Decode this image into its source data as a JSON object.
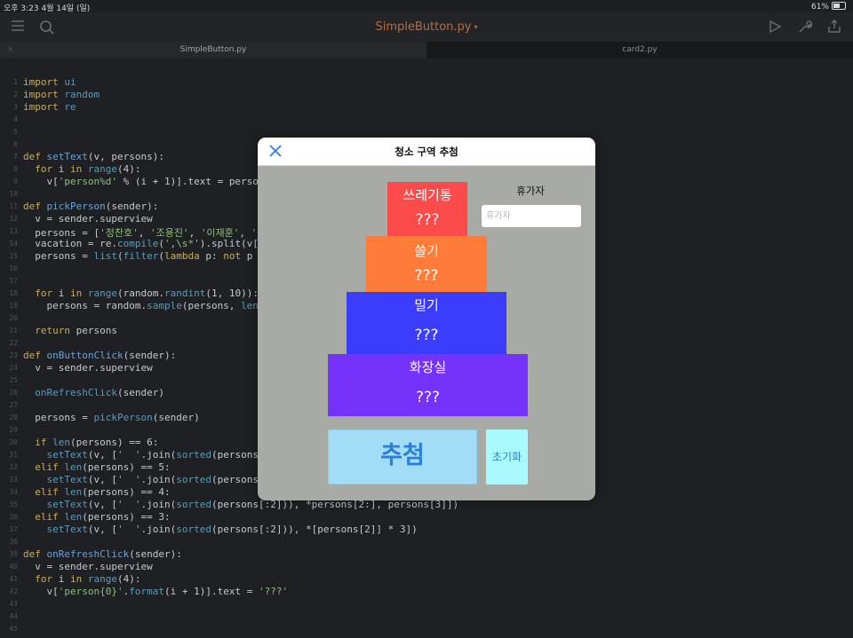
{
  "status_bar": {
    "time_date": "오후 3:23   4월 14일 (일)",
    "battery": "61%"
  },
  "toolbar": {
    "title": "SimpleButton.py",
    "title_caret": "▾"
  },
  "tabs": [
    {
      "label": "SimpleButton.py",
      "close": "×"
    },
    {
      "label": "card2.py"
    }
  ],
  "code_lines": [
    {
      "n": "1",
      "html": "<span class=\"kw\">import</span> <span class=\"bi\">ui</span>"
    },
    {
      "n": "2",
      "html": "<span class=\"kw\">import</span> <span class=\"bi\">random</span>"
    },
    {
      "n": "3",
      "html": "<span class=\"kw\">import</span> <span class=\"bi\">re</span>"
    },
    {
      "n": "4",
      "html": ""
    },
    {
      "n": "5",
      "html": ""
    },
    {
      "n": "6",
      "html": ""
    },
    {
      "n": "7",
      "html": "<span class=\"kw\">def</span> <span class=\"fn\">setText</span>(v, persons):"
    },
    {
      "n": "8",
      "html": "  <span class=\"kw\">for</span> i <span class=\"kw\">in</span> <span class=\"bi\">range</span>(4):"
    },
    {
      "n": "9",
      "html": "    v[<span class=\"st\">'person%d'</span> % (i + 1)].text = persons"
    },
    {
      "n": "10",
      "html": ""
    },
    {
      "n": "11",
      "html": "<span class=\"kw\">def</span> <span class=\"fn\">pickPerson</span>(sender):"
    },
    {
      "n": "12",
      "html": "  v = sender.superview"
    },
    {
      "n": "13",
      "html": "  persons = [<span class=\"st\">'정찬호'</span>, <span class=\"st\">'조용진'</span>, <span class=\"st\">'이재훈'</span>, <span class=\"st\">'유성</span>"
    },
    {
      "n": "14",
      "html": "  vacation = re.<span class=\"bi\">compile</span>(<span class=\"st\">',\\s*'</span>).split(v['v"
    },
    {
      "n": "15",
      "html": "  persons = <span class=\"bi\">list</span>(<span class=\"bi\">filter</span>(<span class=\"kw\">lambda</span> p: <span class=\"kw\">not</span> p <span class=\"kw\">in</span>"
    },
    {
      "n": "16",
      "html": ""
    },
    {
      "n": "17",
      "html": ""
    },
    {
      "n": "18",
      "html": "  <span class=\"kw\">for</span> i <span class=\"kw\">in</span> <span class=\"bi\">range</span>(random.<span class=\"bi\">randint</span>(1, 10)):"
    },
    {
      "n": "19",
      "html": "    persons = random.<span class=\"bi\">sample</span>(persons, <span class=\"bi\">len</span>(p"
    },
    {
      "n": "20",
      "html": ""
    },
    {
      "n": "21",
      "html": "  <span class=\"kw\">return</span> persons"
    },
    {
      "n": "22",
      "html": ""
    },
    {
      "n": "23",
      "html": "<span class=\"kw\">def</span> <span class=\"fn\">onButtonClick</span>(sender):"
    },
    {
      "n": "24",
      "html": "  v = sender.superview"
    },
    {
      "n": "25",
      "html": ""
    },
    {
      "n": "26",
      "html": "  <span class=\"bi\">onRefreshClick</span>(sender)"
    },
    {
      "n": "27",
      "html": ""
    },
    {
      "n": "28",
      "html": "  persons = <span class=\"bi\">pickPerson</span>(sender)"
    },
    {
      "n": "29",
      "html": ""
    },
    {
      "n": "30",
      "html": "  <span class=\"kw\">if</span> <span class=\"bi\">len</span>(persons) == 6:"
    },
    {
      "n": "31",
      "html": "    <span class=\"bi\">setText</span>(v, [<span class=\"st\">'  '</span>.join(<span class=\"bi\">sorted</span>(persons[:"
    },
    {
      "n": "32",
      "html": "  <span class=\"kw\">elif</span> <span class=\"bi\">len</span>(persons) == 5:"
    },
    {
      "n": "33",
      "html": "    <span class=\"bi\">setText</span>(v, [<span class=\"st\">'  '</span>.join(<span class=\"bi\">sorted</span>(persons[:"
    },
    {
      "n": "34",
      "html": "  <span class=\"kw\">elif</span> <span class=\"bi\">len</span>(persons) == 4:"
    },
    {
      "n": "35",
      "html": "    <span class=\"bi\">setText</span>(v, [<span class=\"st\">'  '</span>.join(<span class=\"bi\">sorted</span>(persons[:2])), *persons[2:], persons[3]])"
    },
    {
      "n": "36",
      "html": "  <span class=\"kw\">elif</span> <span class=\"bi\">len</span>(persons) == 3:"
    },
    {
      "n": "37",
      "html": "    <span class=\"bi\">setText</span>(v, [<span class=\"st\">'  '</span>.join(<span class=\"bi\">sorted</span>(persons[:2])), *[persons[2]] * 3])"
    },
    {
      "n": "38",
      "html": ""
    },
    {
      "n": "39",
      "html": "<span class=\"kw\">def</span> <span class=\"fn\">onRefreshClick</span>(sender):"
    },
    {
      "n": "40",
      "html": "  v = sender.superview"
    },
    {
      "n": "41",
      "html": "  <span class=\"kw\">for</span> i <span class=\"kw\">in</span> <span class=\"bi\">range</span>(4):"
    },
    {
      "n": "42",
      "html": "    v[<span class=\"st\">'person{0}'</span>.<span class=\"bi\">format</span>(i + 1)].text = <span class=\"st\">'???'</span>"
    },
    {
      "n": "43",
      "html": ""
    },
    {
      "n": "44",
      "html": ""
    },
    {
      "n": "45",
      "html": ""
    }
  ],
  "modal": {
    "title": "청소 구역 추첨",
    "zones": [
      {
        "name": "쓰레기통",
        "person": "???",
        "color": "#fd4a4b"
      },
      {
        "name": "쓸기",
        "person": "???",
        "color": "#fe7b39"
      },
      {
        "name": "밀기",
        "person": "???",
        "color": "#3c3cfb"
      },
      {
        "name": "화장실",
        "person": "???",
        "color": "#7432fb"
      }
    ],
    "vacation_label": "휴가자",
    "vacation_placeholder": "휴가자",
    "draw_button": "추첨",
    "reset_button": "초기화"
  }
}
